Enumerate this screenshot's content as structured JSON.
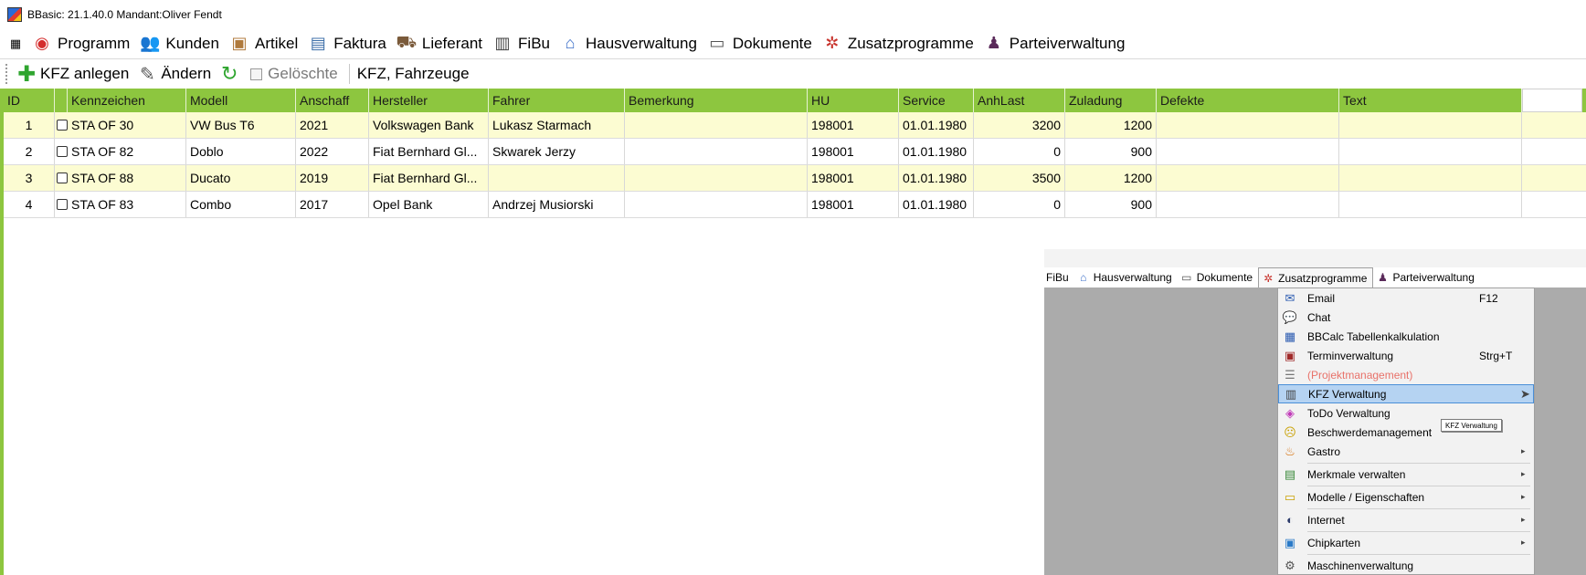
{
  "window": {
    "title": "BBasic: 21.1.40.0 Mandant:Oliver Fendt"
  },
  "menubar": {
    "items": [
      {
        "label": "Programm",
        "icon": "program-icon"
      },
      {
        "label": "Kunden",
        "icon": "customers-icon"
      },
      {
        "label": "Artikel",
        "icon": "articles-icon"
      },
      {
        "label": "Faktura",
        "icon": "invoice-icon"
      },
      {
        "label": "Lieferant",
        "icon": "supplier-icon"
      },
      {
        "label": "FiBu",
        "icon": "accounting-icon"
      },
      {
        "label": "Hausverwaltung",
        "icon": "house-icon"
      },
      {
        "label": "Dokumente",
        "icon": "documents-icon"
      },
      {
        "label": "Zusatzprogramme",
        "icon": "addons-icon"
      },
      {
        "label": "Parteiverwaltung",
        "icon": "party-icon"
      }
    ]
  },
  "toolbar": {
    "add_label": "KFZ anlegen",
    "edit_label": "Ändern",
    "deleted_label": "Gelöschte",
    "view_title": "KFZ, Fahrzeuge"
  },
  "grid": {
    "columns": [
      "ID",
      "",
      "Kennzeichen",
      "Modell",
      "Anschaff",
      "Hersteller",
      "Fahrer",
      "Bemerkung",
      "HU",
      "Service",
      "AnhLast",
      "Zuladung",
      "Defekte",
      "Text"
    ],
    "rows": [
      {
        "id": "1",
        "kennzeichen": "STA OF 30",
        "modell": "VW Bus T6",
        "anschaff": "2021",
        "hersteller": "Volkswagen Bank",
        "fahrer": "Lukasz Starmach",
        "bemerkung": "",
        "hu": "198001",
        "service": "01.01.1980",
        "anhlast": "3200",
        "zuladung": "1200",
        "defekte": "",
        "text": ""
      },
      {
        "id": "2",
        "kennzeichen": "STA OF 82",
        "modell": "Doblo",
        "anschaff": "2022",
        "hersteller": "Fiat  Bernhard Gl...",
        "fahrer": "Skwarek Jerzy",
        "bemerkung": "",
        "hu": "198001",
        "service": "01.01.1980",
        "anhlast": "0",
        "zuladung": "900",
        "defekte": "",
        "text": ""
      },
      {
        "id": "3",
        "kennzeichen": "STA OF 88",
        "modell": "Ducato",
        "anschaff": "2019",
        "hersteller": "Fiat  Bernhard Gl...",
        "fahrer": "",
        "bemerkung": "",
        "hu": "198001",
        "service": "01.01.1980",
        "anhlast": "3500",
        "zuladung": "1200",
        "defekte": "",
        "text": ""
      },
      {
        "id": "4",
        "kennzeichen": "STA OF 83",
        "modell": "Combo",
        "anschaff": "2017",
        "hersteller": "Opel Bank",
        "fahrer": "Andrzej Musiorski",
        "bemerkung": "",
        "hu": "198001",
        "service": "01.01.1980",
        "anhlast": "0",
        "zuladung": "900",
        "defekte": "",
        "text": ""
      }
    ]
  },
  "panel": {
    "menu": [
      {
        "label": "FiBu"
      },
      {
        "label": "Hausverwaltung"
      },
      {
        "label": "Dokumente"
      },
      {
        "label": "Zusatzprogramme"
      },
      {
        "label": "Parteiverwaltung"
      }
    ],
    "dropdown": [
      {
        "label": "Email",
        "shortcut": "F12",
        "icon": "email-icon"
      },
      {
        "label": "Chat",
        "shortcut": "",
        "icon": "chat-icon"
      },
      {
        "label": "BBCalc Tabellenkalkulation",
        "shortcut": "",
        "icon": "spreadsheet-icon"
      },
      {
        "label": "Terminverwaltung",
        "shortcut": "Strg+T",
        "icon": "calendar-icon"
      },
      {
        "label": "(Projektmanagement)",
        "shortcut": "",
        "icon": "project-icon"
      },
      {
        "label": "KFZ Verwaltung",
        "shortcut": "",
        "icon": "vehicle-icon"
      },
      {
        "label": "ToDo Verwaltung",
        "shortcut": "",
        "icon": "todo-icon"
      },
      {
        "label": "Beschwerdemanagement",
        "shortcut": "",
        "icon": "complaint-icon"
      },
      {
        "label": "Gastro",
        "shortcut": "",
        "icon": "gastro-icon"
      },
      {
        "label": "Merkmale verwalten",
        "shortcut": "",
        "icon": "features-icon"
      },
      {
        "label": "Modelle / Eigenschaften",
        "shortcut": "",
        "icon": "models-icon"
      },
      {
        "label": "Internet",
        "shortcut": "",
        "icon": "internet-icon"
      },
      {
        "label": "Chipkarten",
        "shortcut": "",
        "icon": "chipcard-icon"
      },
      {
        "label": "Maschinenverwaltung",
        "shortcut": "",
        "icon": "machine-icon"
      }
    ],
    "tooltip": "KFZ Verwaltung"
  },
  "colors": {
    "header_green": "#8dc63f",
    "row_highlight": "#fcfcd2",
    "menu_hover": "#b5d3f2",
    "disabled_text": "#e8726a"
  }
}
